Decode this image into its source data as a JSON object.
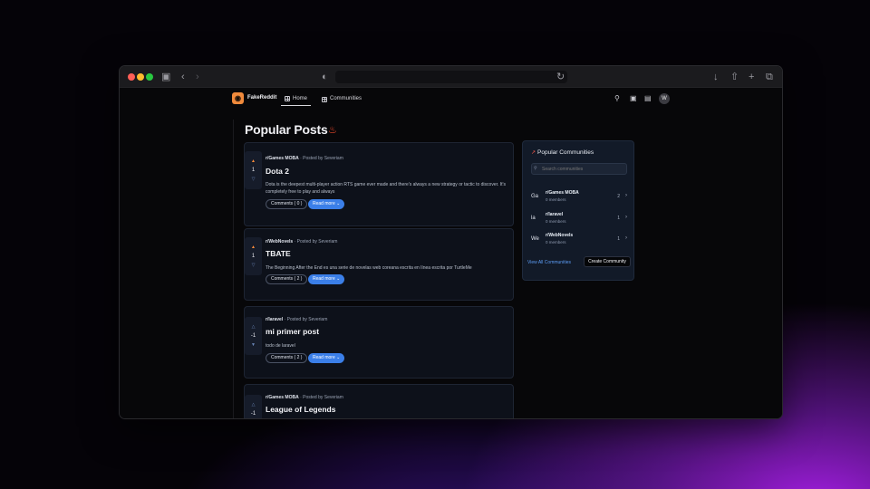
{
  "app": {
    "brand": "FakeReddit",
    "avatar_initial": "W"
  },
  "nav": {
    "home_label": "Home",
    "communities_label": "Communities"
  },
  "page": {
    "title": "Popular Posts"
  },
  "posts": [
    {
      "community": "r/Games MOBA",
      "author": "· Posted by Severiam",
      "score": "1",
      "title": "Dota 2",
      "body": "Dota is the deepest multi-player action RTS game ever made and there's always a new strategy or tactic to discover. It's completely free to play and always",
      "comments_label": "Comments ( 0 )",
      "read_more_label": "Read more"
    },
    {
      "community": "r/WebNovels",
      "author": "· Posted by Severiam",
      "score": "1",
      "title": "TBATE",
      "body": "The Beginning After the End es una serie de novelas web coreana escrita en línea escrita por TurtleMe",
      "comments_label": "Comments ( 2 )",
      "read_more_label": "Read more"
    },
    {
      "community": "r/laravel",
      "author": "· Posted by Severiam",
      "score": "-1",
      "title": "mi primer post",
      "body": "todo de laravel",
      "comments_label": "Comments ( 2 )",
      "read_more_label": "Read more"
    },
    {
      "community": "r/Games MOBA",
      "author": "· Posted by Severiam",
      "score": "-1",
      "title": "League of Legends"
    }
  ],
  "sidebar": {
    "title": "Popular Communities",
    "search_placeholder": "Search communities",
    "communities": [
      {
        "abbr": "Ga",
        "name": "r/Games MOBA",
        "members": "0 members",
        "count": "2"
      },
      {
        "abbr": "la",
        "name": "r/laravel",
        "members": "0 members",
        "count": "1"
      },
      {
        "abbr": "We",
        "name": "r/WebNovels",
        "members": "0 members",
        "count": "1"
      }
    ],
    "view_all_label": "View All Communities",
    "create_label": "Create Community"
  },
  "colors": {
    "accent": "#3b7fe8",
    "upvote": "#ff8c3a",
    "flame": "#ff4d2e",
    "link": "#5c9cf5"
  }
}
